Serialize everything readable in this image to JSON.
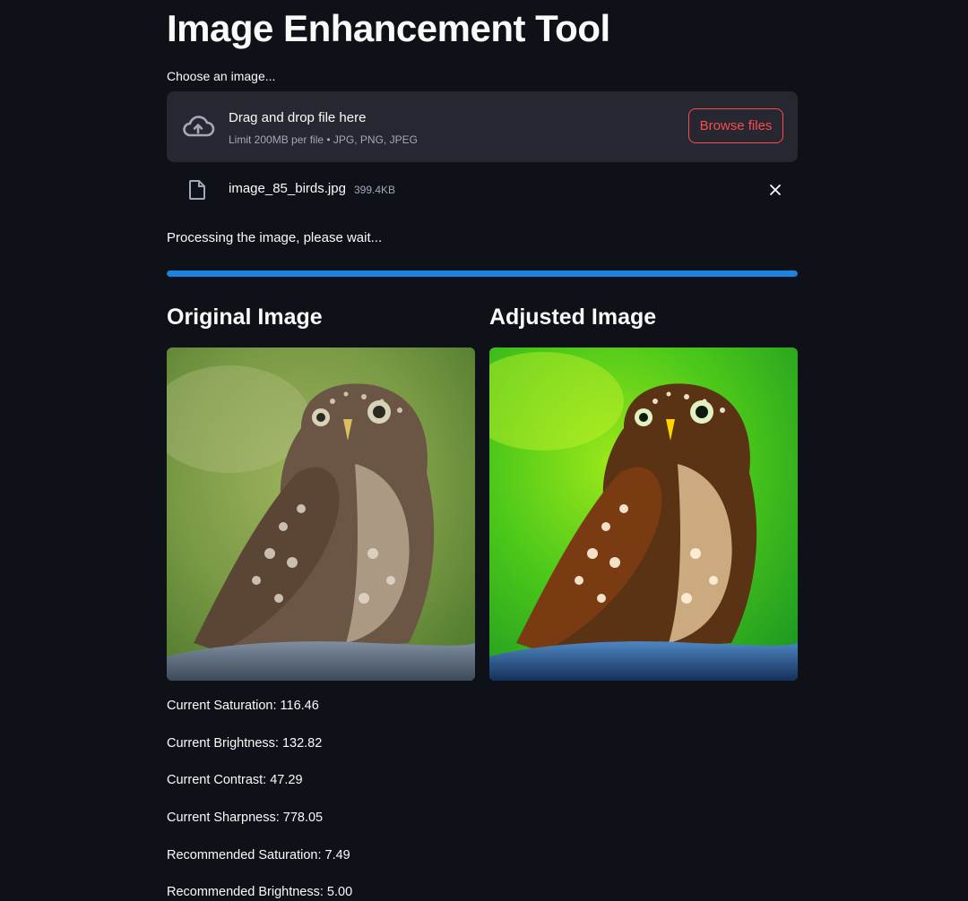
{
  "title": "Image Enhancement Tool",
  "uploader": {
    "label": "Choose an image...",
    "drop_text": "Drag and drop file here",
    "limit_text": "Limit 200MB per file • JPG, PNG, JPEG",
    "browse_label": "Browse files",
    "icon": "cloud-upload-icon"
  },
  "file": {
    "name": "image_85_birds.jpg",
    "size": "399.4KB",
    "icon": "file-icon",
    "remove_icon": "close-icon"
  },
  "status_text": "Processing the image, please wait...",
  "progress": 1.0,
  "columns": {
    "original_title": "Original Image",
    "adjusted_title": "Adjusted Image"
  },
  "metrics": [
    "Current Saturation: 116.46",
    "Current Brightness: 132.82",
    "Current Contrast: 47.29",
    "Current Sharpness: 778.05",
    "Recommended Saturation: 7.49",
    "Recommended Brightness: 5.00"
  ],
  "colors": {
    "background": "#0e1117",
    "panel": "#262730",
    "accent_red": "#ff4b4b",
    "progress_blue": "#1c83e1"
  }
}
